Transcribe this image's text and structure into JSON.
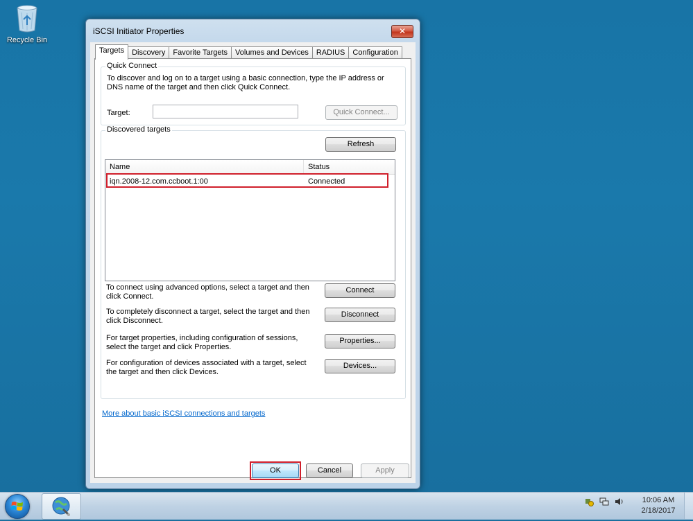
{
  "desktop": {
    "recycle_bin_label": "Recycle Bin"
  },
  "window": {
    "title": "iSCSI Initiator Properties",
    "close_glyph": "✕",
    "tabs": [
      {
        "label": "Targets",
        "active": true
      },
      {
        "label": "Discovery"
      },
      {
        "label": "Favorite Targets"
      },
      {
        "label": "Volumes and Devices"
      },
      {
        "label": "RADIUS"
      },
      {
        "label": "Configuration"
      }
    ],
    "quick_connect": {
      "group_label": "Quick Connect",
      "description": "To discover and log on to a target using a basic connection, type the IP address or DNS name of the target and then click Quick Connect.",
      "target_label": "Target:",
      "target_value": "",
      "quick_connect_button": "Quick Connect..."
    },
    "discovered": {
      "group_label": "Discovered targets",
      "refresh_button": "Refresh",
      "columns": {
        "name": "Name",
        "status": "Status"
      },
      "rows": [
        {
          "name": "iqn.2008-12.com.ccboot.1:00",
          "status": "Connected"
        }
      ],
      "actions": [
        {
          "text": "To connect using advanced options, select a target and then click Connect.",
          "button": "Connect"
        },
        {
          "text": "To completely disconnect a target, select the target and then click Disconnect.",
          "button": "Disconnect"
        },
        {
          "text": "For target properties, including configuration of sessions, select the target and click Properties.",
          "button": "Properties..."
        },
        {
          "text": "For configuration of devices associated with a target, select the target and then click Devices.",
          "button": "Devices..."
        }
      ]
    },
    "help_link": "More about basic iSCSI connections and targets",
    "buttons": {
      "ok": "OK",
      "cancel": "Cancel",
      "apply": "Apply"
    }
  },
  "taskbar": {
    "clock_time": "10:06 AM",
    "clock_date": "2/18/2017"
  },
  "colors": {
    "highlight": "#d01f2b",
    "desktop": "#1a6f9e",
    "link": "#0066cc"
  }
}
